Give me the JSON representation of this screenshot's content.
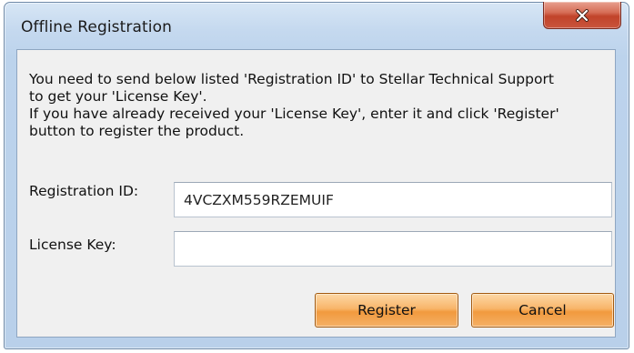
{
  "window": {
    "title": "Offline Registration",
    "close_symbol": "x"
  },
  "message": {
    "lines": [
      "You need to send below listed 'Registration ID' to Stellar Technical Support",
      "to get your 'License Key'.",
      "If you have already received your 'License Key', enter it and click 'Register'",
      "button to register the product."
    ]
  },
  "fields": {
    "registration_id": {
      "label": "Registration ID:",
      "value": "4VCZXM559RZEMUIF"
    },
    "license_key": {
      "label": "License Key:",
      "value": ""
    }
  },
  "buttons": {
    "register": "Register",
    "cancel": "Cancel"
  },
  "colors": {
    "title_bar": "#c5d9ef",
    "close_button": "#c9543c",
    "action_button": "#f5b066"
  },
  "icons": {
    "close": "close-icon"
  }
}
